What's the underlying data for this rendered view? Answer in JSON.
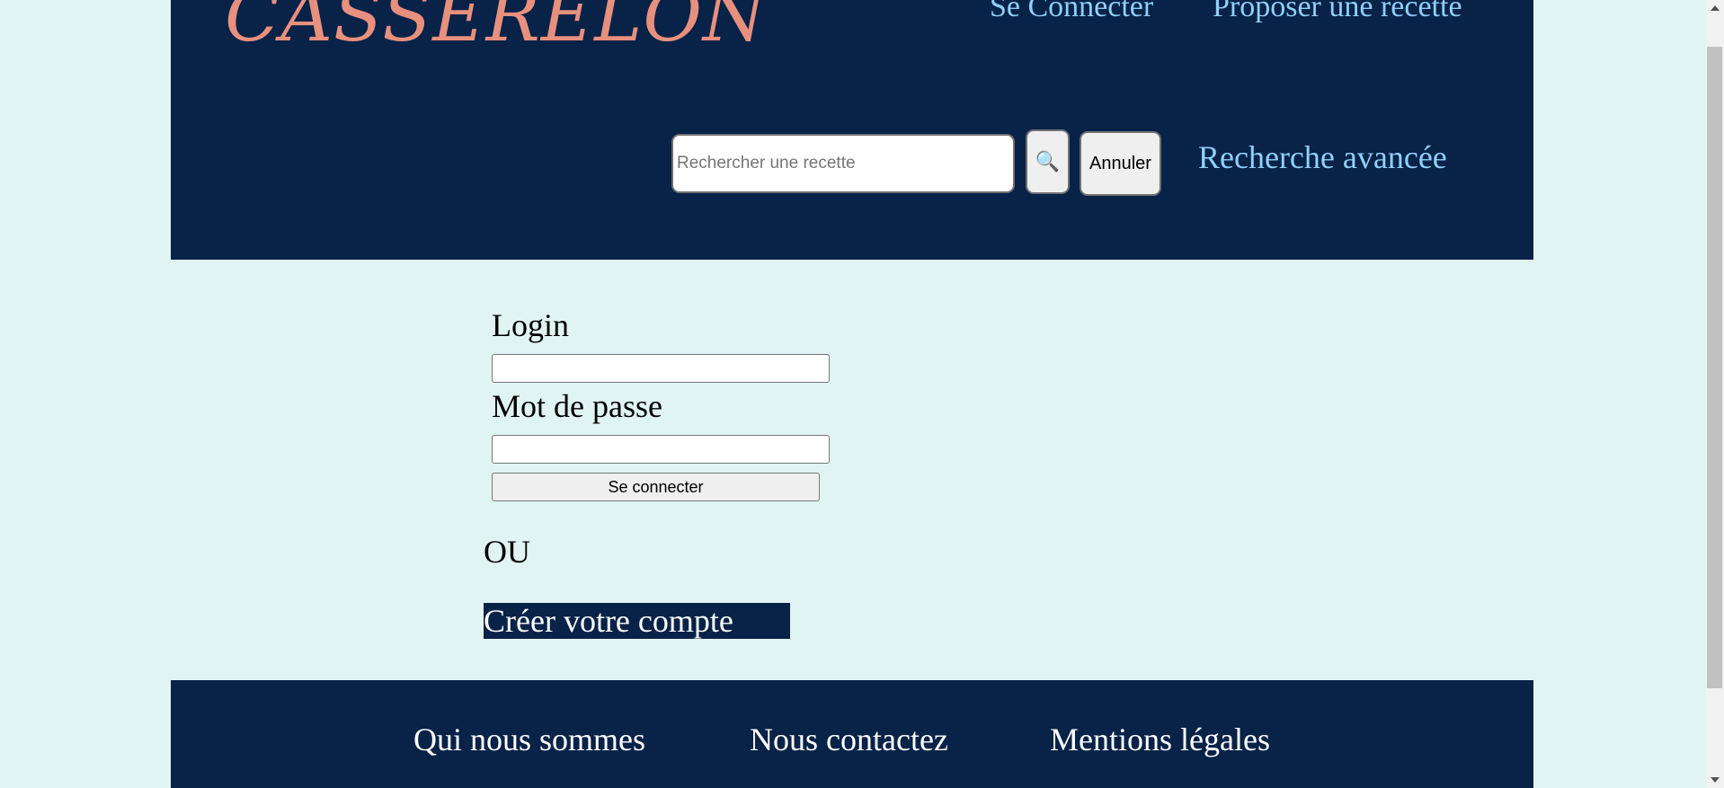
{
  "header": {
    "logo": "CASSERELON",
    "nav": {
      "login_link": "Se Connecter",
      "propose_link": "Proposer une recette"
    },
    "search": {
      "placeholder": "Rechercher une recette",
      "value": "",
      "search_icon": "magnifier-icon",
      "search_glyph": "🔍",
      "cancel_label": "Annuler",
      "advanced_link": "Recherche avancée"
    }
  },
  "login_form": {
    "login_label": "Login",
    "login_value": "",
    "password_label": "Mot de passe",
    "password_value": "",
    "submit_label": "Se connecter",
    "or_text": "OU",
    "create_account_label": "Créer votre compte"
  },
  "footer": {
    "links": [
      "Qui nous sommes",
      "Nous contactez",
      "Mentions légales"
    ]
  },
  "colors": {
    "page_background": "#e1f4f4",
    "header_background": "#082248",
    "logo": "#e8907e",
    "nav_link": "#8fd0f8",
    "footer_text": "#ffffff"
  }
}
